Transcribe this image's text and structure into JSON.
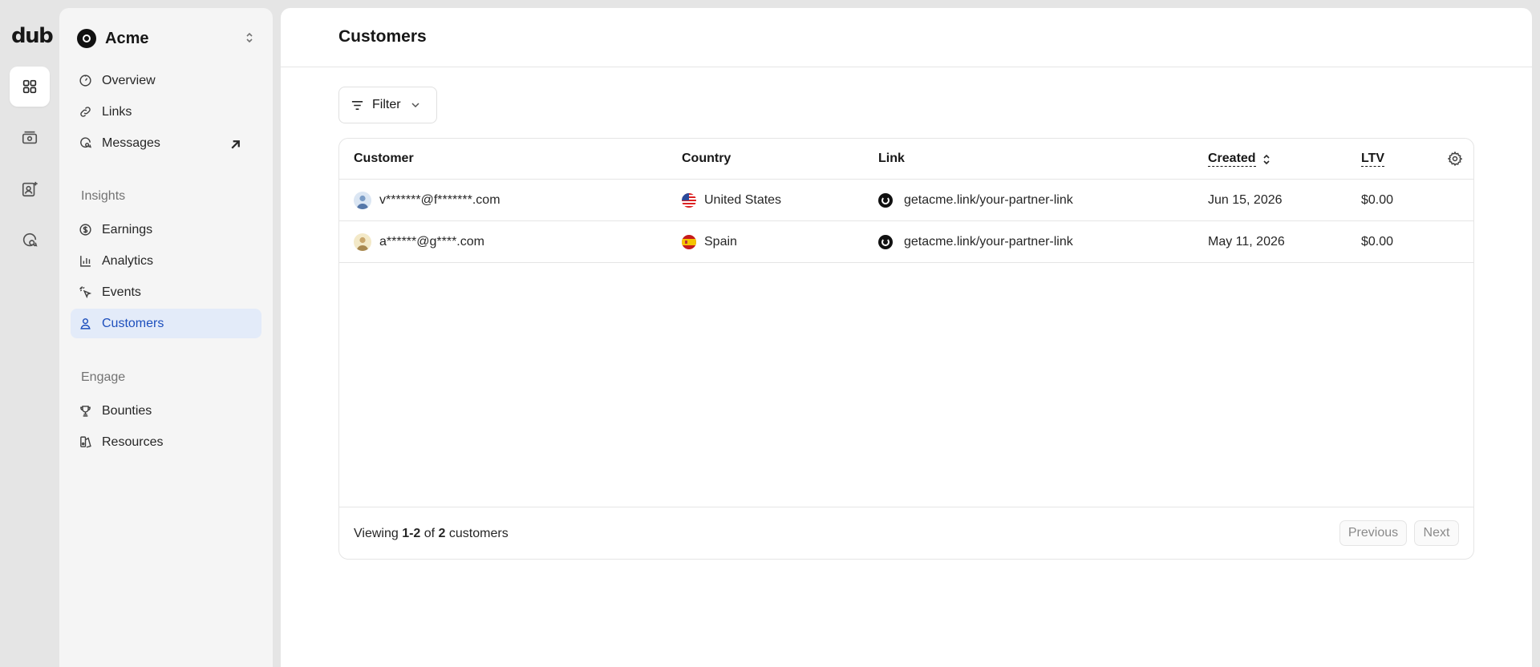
{
  "brand": {
    "logo_text": "dub"
  },
  "workspace": {
    "name": "Acme"
  },
  "nav": {
    "items_top": [
      {
        "label": "Overview",
        "icon": "gauge-icon"
      },
      {
        "label": "Links",
        "icon": "link-icon"
      },
      {
        "label": "Messages",
        "icon": "message-icon",
        "external": true
      }
    ],
    "insights_label": "Insights",
    "insights": [
      {
        "label": "Earnings",
        "icon": "dollar-icon"
      },
      {
        "label": "Analytics",
        "icon": "chart-icon"
      },
      {
        "label": "Events",
        "icon": "cursor-rays-icon"
      },
      {
        "label": "Customers",
        "icon": "user-icon",
        "active": true
      }
    ],
    "engage_label": "Engage",
    "engage": [
      {
        "label": "Bounties",
        "icon": "trophy-icon"
      },
      {
        "label": "Resources",
        "icon": "resources-icon"
      }
    ]
  },
  "page": {
    "title": "Customers"
  },
  "filter": {
    "label": "Filter"
  },
  "table": {
    "columns": {
      "customer": "Customer",
      "country": "Country",
      "link": "Link",
      "created": "Created",
      "ltv": "LTV"
    },
    "rows": [
      {
        "customer": "v*******@f*******.com",
        "country": "United States",
        "flag": "us-flag-icon",
        "link": "getacme.link/your-partner-link",
        "created": "Jun 15, 2026",
        "ltv": "$0.00"
      },
      {
        "customer": "a******@g****.com",
        "country": "Spain",
        "flag": "es-flag-icon",
        "link": "getacme.link/your-partner-link",
        "created": "May 11, 2026",
        "ltv": "$0.00"
      }
    ]
  },
  "footer": {
    "prefix": "Viewing ",
    "range": "1-2",
    "of": " of ",
    "total": "2",
    "suffix": " customers"
  },
  "pagination": {
    "previous": "Previous",
    "next": "Next"
  },
  "colors": {
    "accent": "#1d4fbd",
    "active_bg": "#e3ebf9"
  }
}
